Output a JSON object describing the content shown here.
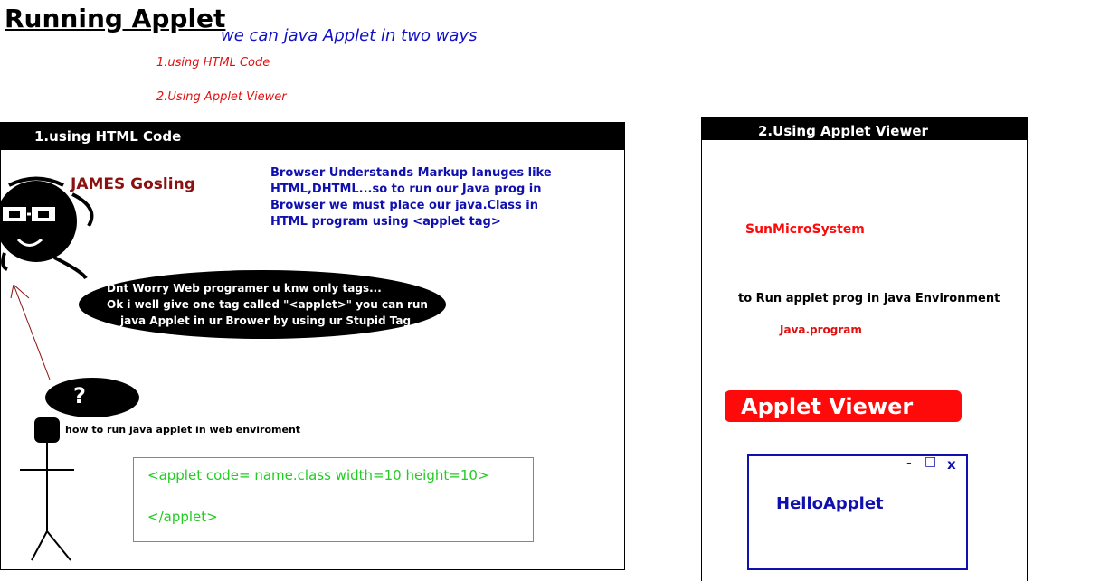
{
  "header": {
    "title": "Running Applet",
    "subtitle": "we can java Applet in two ways",
    "ways": [
      "1.using HTML Code",
      "2.Using Applet Viewer"
    ]
  },
  "left_panel": {
    "heading": "1.using HTML Code",
    "person_name": "JAMES Gosling",
    "description": [
      "Browser Understands Markup lanuges like",
      "HTML,DHTML...so to run our Java prog in",
      "Browser we must place our java.Class in",
      "HTML program using <applet tag>"
    ],
    "speech": [
      "Dnt Worry Web programer u knw only tags...",
      "Ok i well give one tag called \"<applet>\" you can run",
      "java Applet in ur Brower by using ur Stupid Tag"
    ],
    "question_mark": "?",
    "question": "how to run java applet in web enviroment",
    "code": [
      "<applet code= name.class width=10 height=10>",
      "</applet>"
    ]
  },
  "right_panel": {
    "heading": "2.Using Applet Viewer",
    "sun_label": "SunMicroSystem",
    "run_text": "to Run applet prog in java Environment",
    "program_label": "Java.program",
    "viewer_label": "Applet Viewer",
    "window_controls": [
      "-",
      "□",
      "x"
    ],
    "window_text": "HelloApplet"
  },
  "colors": {
    "title_blue": "#1010c8",
    "red": "#e01010",
    "dark_red": "#8b1010",
    "green": "#22cc22",
    "sun_yellow": "#ffee00",
    "viewer_red": "#ff0a0a"
  }
}
